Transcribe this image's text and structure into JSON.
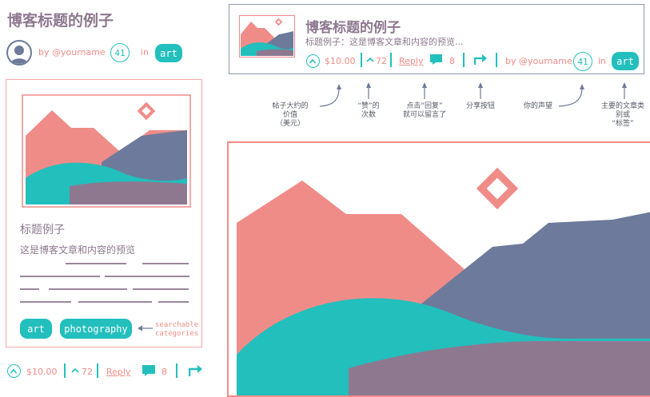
{
  "left": {
    "title": "博客标题的例子",
    "by": "by @yourname",
    "count": "41",
    "in": "in",
    "tag": "art",
    "card": {
      "heading": "标题例子",
      "preview": "这是博客文章和内容的预览",
      "tags": [
        "art",
        "photography"
      ],
      "tags_note": "searchable\ncategories"
    },
    "footer": {
      "price": "$10.00",
      "likes": "72",
      "reply": "Reply",
      "comments": "8"
    }
  },
  "top": {
    "title": "博客标题的例子",
    "subtitle": "标题例子：这是博客文章和内容的预览...",
    "price": "$10.00",
    "likes": "72",
    "reply": "Reply",
    "comments": "8",
    "by": "by @yourname",
    "count": "41",
    "in": "in",
    "tag": "art"
  },
  "annotations": {
    "price": "帖子大约的\n价值\n（美元）",
    "likes": "“赞”的\n次数",
    "reply": "点击“回复”\n就可以留言了",
    "share": "分享按钮",
    "voice": "你的声望",
    "tag": "主要的文章类\n别或\n“标签”"
  },
  "colors": {
    "pink": "#f08c88",
    "teal": "#22bfbd",
    "slate": "#6d7a9b",
    "mauve": "#8e7890"
  }
}
